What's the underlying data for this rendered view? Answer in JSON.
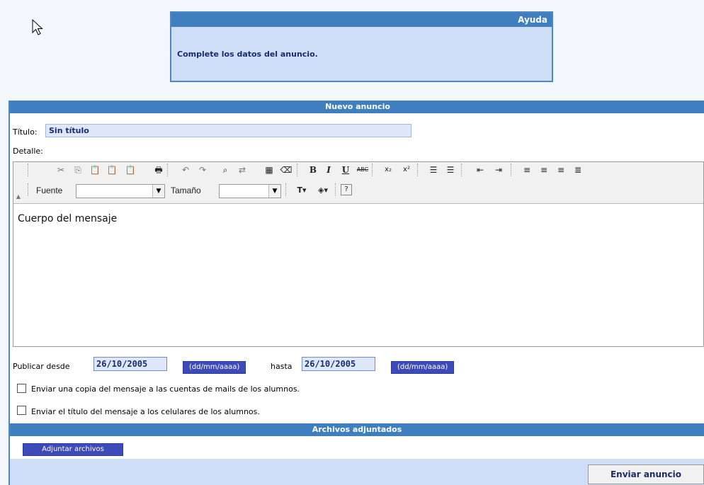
{
  "help": {
    "header": "Ayuda",
    "text": "Complete los datos del anuncio."
  },
  "form": {
    "header": "Nuevo anuncio",
    "titulo_label": "Título:",
    "titulo_value": "Sin título",
    "detalle_label": "Detalle:",
    "editor": {
      "toolbar_icons": [
        "cut-icon",
        "copy-icon",
        "paste-icon",
        "paste-text-icon",
        "paste-word-icon",
        "print-icon",
        "undo-icon",
        "redo-icon",
        "find-icon",
        "replace-icon",
        "select-all-icon",
        "remove-format-icon",
        "bold-icon",
        "italic-icon",
        "underline-icon",
        "strikethrough-icon",
        "subscript-icon",
        "superscript-icon",
        "ordered-list-icon",
        "unordered-list-icon",
        "outdent-icon",
        "indent-icon",
        "align-left-icon",
        "align-center-icon",
        "align-right-icon",
        "justify-icon",
        "text-color-icon",
        "background-color-icon",
        "about-icon"
      ],
      "font_label": "Fuente",
      "font_value": "",
      "size_label": "Tamaño",
      "size_value": "",
      "body": "Cuerpo del mensaje"
    },
    "publicar_desde_label": "Publicar desde",
    "fecha_desde": "26/10/2005",
    "fecha_format": "(dd/mm/aaaa)",
    "hasta_label": "hasta",
    "fecha_hasta": "26/10/2005",
    "checkbox_mails": "Enviar una copia del mensaje a las cuentas de mails de los alumnos.",
    "checkbox_celulares": "Enviar el título del mensaje a los celulares de los alumnos.",
    "adjuntos_header": "Archivos adjuntados",
    "adjuntar_button": "Adjuntar archivos",
    "enviar_button": "Enviar anuncio"
  }
}
